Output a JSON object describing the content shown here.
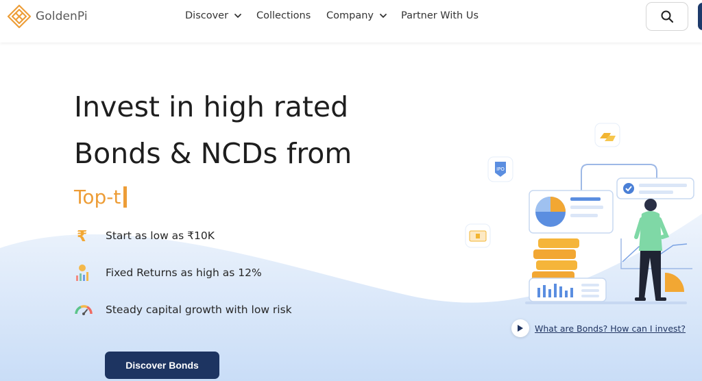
{
  "brand": {
    "name": "GoldenPi",
    "accent": "#ed9d37",
    "navy": "#1d3461"
  },
  "nav": {
    "items": [
      {
        "label": "Discover",
        "dropdown": true
      },
      {
        "label": "Collections",
        "dropdown": false
      },
      {
        "label": "Company",
        "dropdown": true
      },
      {
        "label": "Partner With Us",
        "dropdown": false
      }
    ],
    "search_icon": "search-icon"
  },
  "hero": {
    "headline_line1": "Invest in high rated",
    "headline_line2": "Bonds & NCDs from",
    "typed_text": "Top-t",
    "features": [
      {
        "icon": "rupee-icon",
        "text": "Start as low as ₹10K"
      },
      {
        "icon": "growth-chart-icon",
        "text": "Fixed Returns as high as 12%"
      },
      {
        "icon": "gauge-icon",
        "text": "Steady capital growth with low risk"
      }
    ],
    "cta_label": "Discover Bonds",
    "video_link": "What are Bonds? How can I invest?"
  },
  "illustration": {
    "badge_ipo": "IPO"
  }
}
